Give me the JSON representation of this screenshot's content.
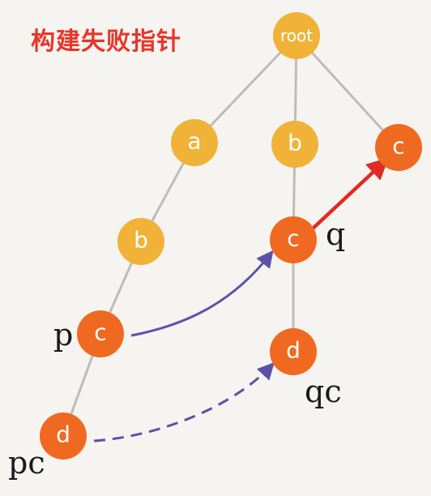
{
  "title": "构建失败指针",
  "colors": {
    "yellow_node": "#f1b238",
    "orange_node": "#ef6a20",
    "edge": "#bdbcb8",
    "fail_arrow": "#5b52a8",
    "highlight_arrow": "#e02a22",
    "title": "#e8362a"
  },
  "nodes": {
    "root": "root",
    "a1": "a",
    "b1": "b",
    "b2": "b",
    "c_left": "c",
    "c_mid": "c",
    "c_right": "c",
    "d_left": "d",
    "d_mid": "d"
  },
  "labels": {
    "p": "p",
    "pc": "pc",
    "q": "q",
    "qc": "qc"
  }
}
